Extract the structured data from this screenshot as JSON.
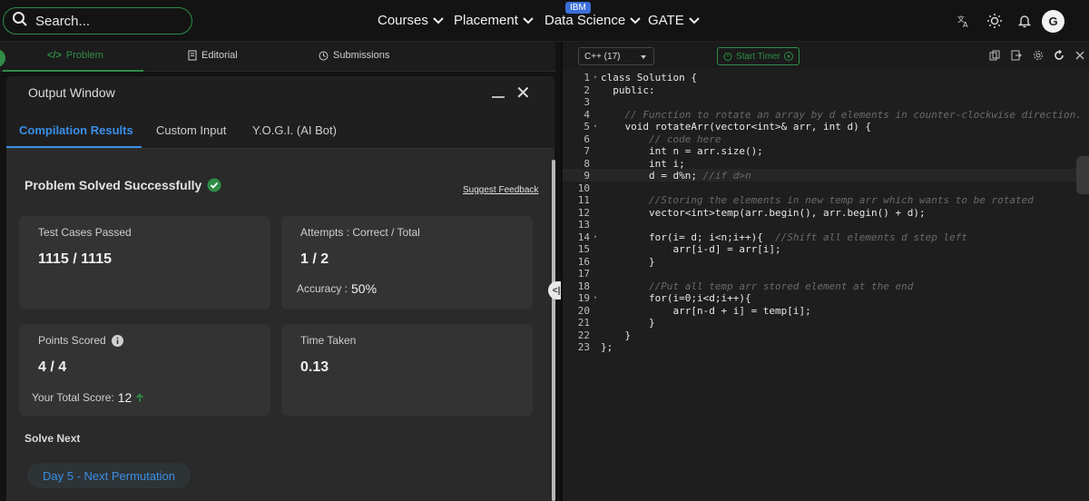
{
  "nav": {
    "search_placeholder": "Search...",
    "items": [
      {
        "label": "Courses"
      },
      {
        "label": "Placement"
      },
      {
        "label": "Data Science"
      },
      {
        "label": "GATE"
      }
    ],
    "badge": "IBM",
    "avatar": "G"
  },
  "left_tabs": [
    {
      "label": "Problem",
      "icon": "code-icon"
    },
    {
      "label": "Editorial",
      "icon": "document-icon"
    },
    {
      "label": "Submissions",
      "icon": "clock-icon"
    }
  ],
  "output": {
    "title": "Output Window",
    "tabs": [
      "Compilation Results",
      "Custom Input",
      "Y.O.G.I. (AI Bot)"
    ],
    "status": "Problem Solved Successfully",
    "feedback": "Suggest Feedback",
    "cards": {
      "tests": {
        "label": "Test Cases Passed",
        "value": "1115 / 1115"
      },
      "attempts": {
        "label": "Attempts : Correct / Total",
        "value": "1 / 2",
        "sub_label": "Accuracy :",
        "sub_value": "50%"
      },
      "points": {
        "label": "Points Scored",
        "value": "4 / 4",
        "sub_label": "Your Total Score:",
        "sub_value": "12"
      },
      "time": {
        "label": "Time Taken",
        "value": "0.13"
      }
    },
    "solve_next": "Solve Next",
    "next_problem": "Day 5 - Next Permutation"
  },
  "editor": {
    "language": "C++ (17)",
    "timer": "Start Timer",
    "lines": [
      "class Solution {",
      "  public:",
      "",
      "    // Function to rotate an array by d elements in counter-clockwise direction.",
      "    void rotateArr(vector<int>& arr, int d) {",
      "        // code here",
      "        int n = arr.size();",
      "        int i;",
      "        d = d%n; //if d>n",
      "",
      "        //Storing the elements in new temp arr which wants to be rotated",
      "        vector<int>temp(arr.begin(), arr.begin() + d);",
      "",
      "        for(i= d; i<n;i++){  //Shift all elements d step left",
      "            arr[i-d] = arr[i];",
      "        }",
      "",
      "        //Put all temp arr stored element at the end",
      "        for(i=0;i<d;i++){",
      "            arr[n-d + i] = temp[i];",
      "        }",
      "    }",
      "};"
    ]
  }
}
